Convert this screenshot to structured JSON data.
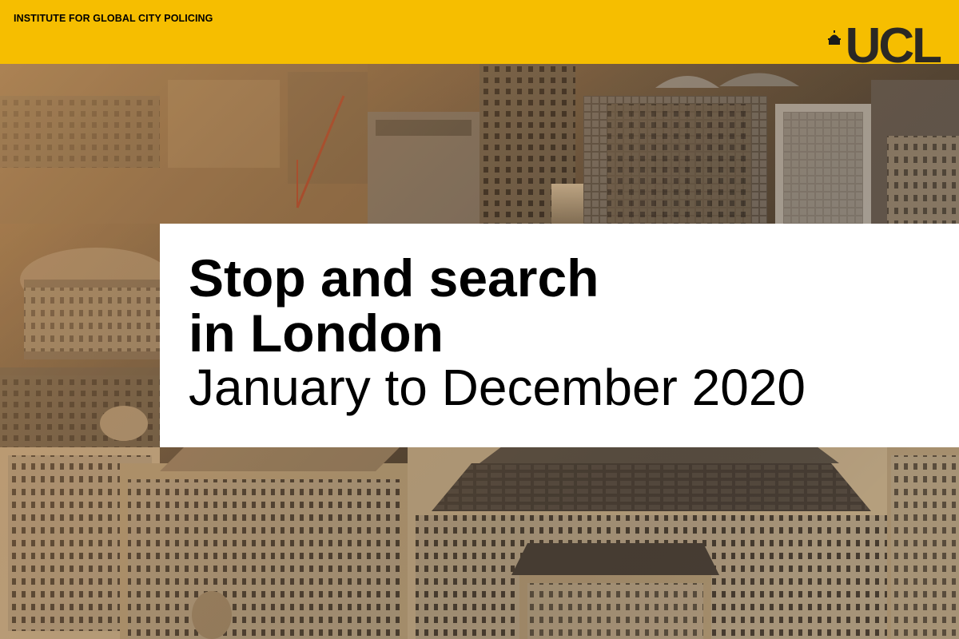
{
  "header": {
    "institute": "INSTITUTE FOR GLOBAL CITY POLICING",
    "logo_text": "UCL",
    "bar_color": "#f6be00"
  },
  "title": {
    "line1": "Stop and search",
    "line2": "in London",
    "subtitle": "January to December 2020"
  },
  "background": {
    "description_icon": "city-aerial-photo"
  }
}
